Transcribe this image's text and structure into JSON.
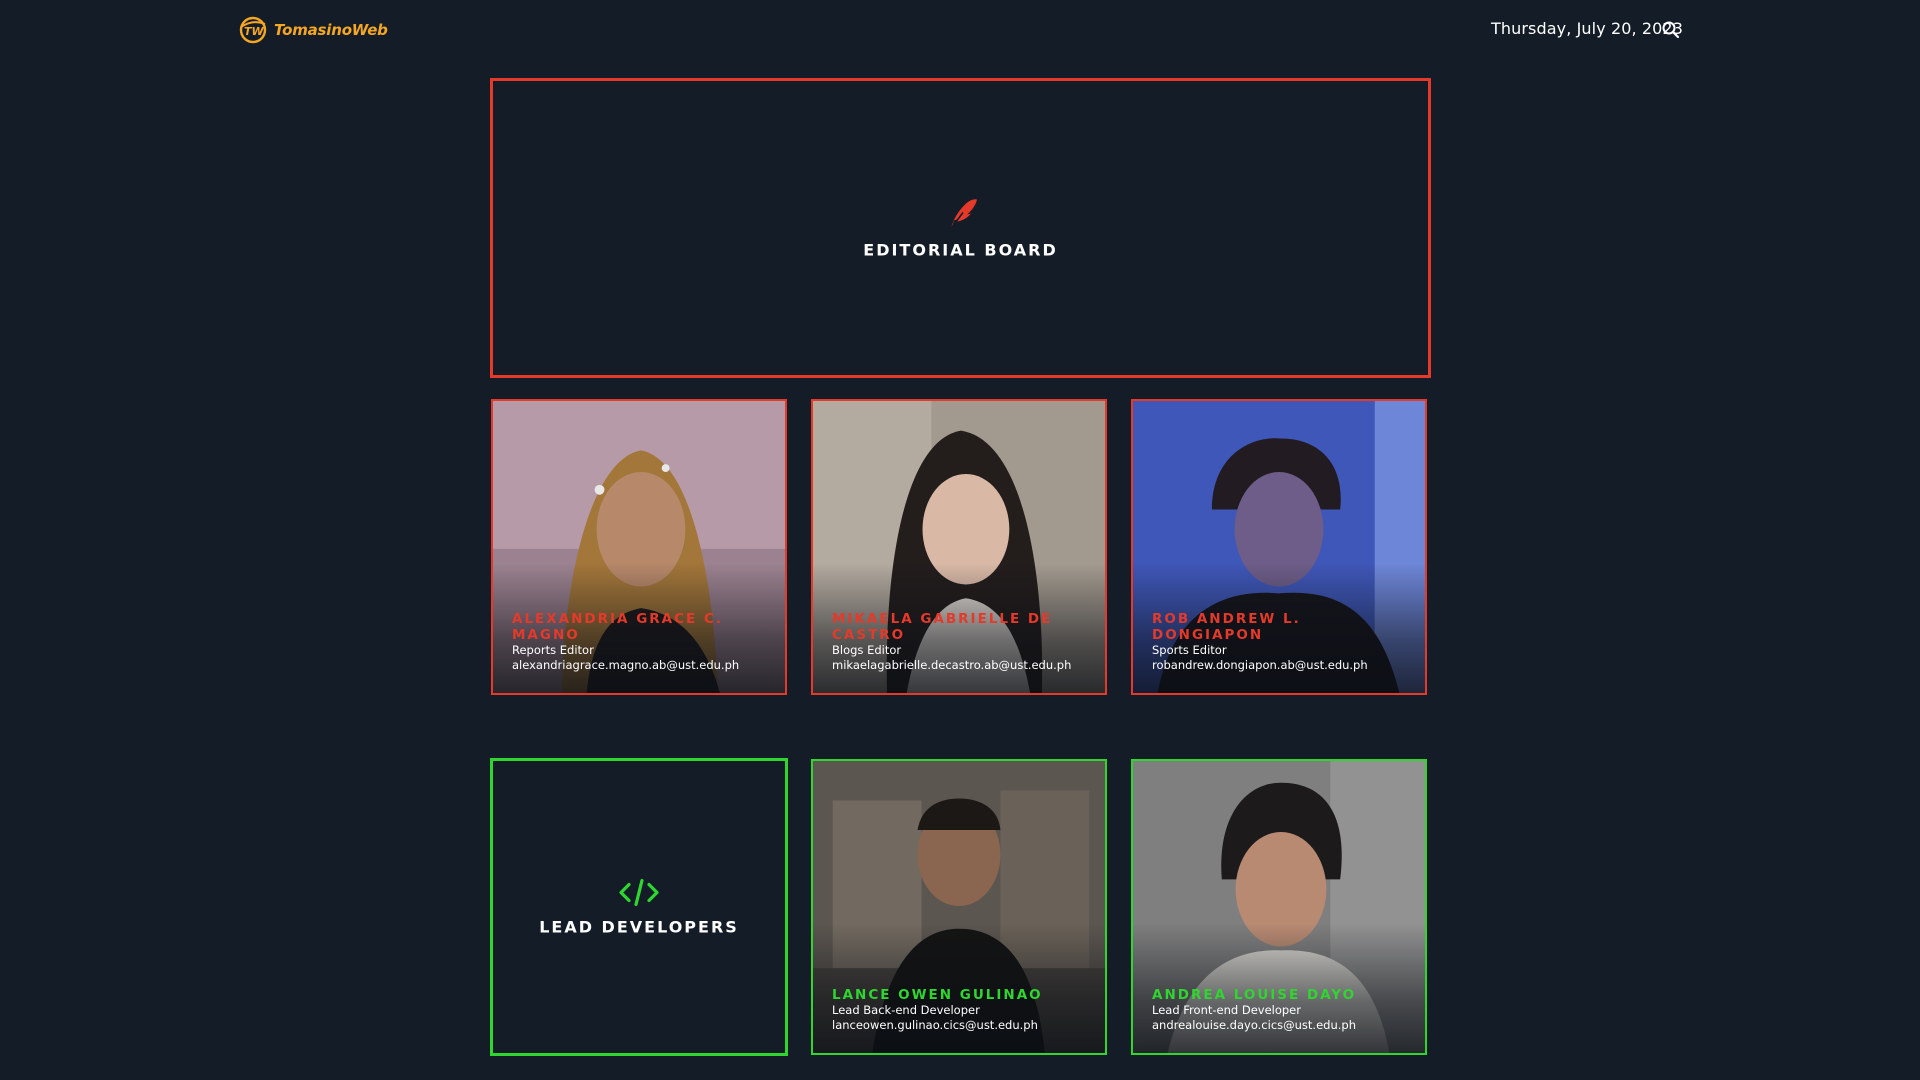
{
  "header": {
    "brand": "TomasinoWeb",
    "date": "Thursday, July 20, 2023"
  },
  "colors": {
    "background": "#141d27",
    "editorial_accent": "#e5392a",
    "developer_accent": "#2fd62f",
    "brand": "#f5a623"
  },
  "editorial_board": {
    "title": "EDITORIAL BOARD",
    "icon": "feather-icon",
    "members": [
      {
        "name": "ALEXANDRIA GRACE C. MAGNO",
        "role": "Reports Editor",
        "email": "alexandriagrace.magno.ab@ust.edu.ph"
      },
      {
        "name": "MIKAELA GABRIELLE DE CASTRO",
        "role": "Blogs Editor",
        "email": "mikaelagabrielle.decastro.ab@ust.edu.ph"
      },
      {
        "name": "ROB ANDREW L. DONGIAPON",
        "role": "Sports Editor",
        "email": "robandrew.dongiapon.ab@ust.edu.ph"
      }
    ]
  },
  "lead_developers": {
    "title": "LEAD DEVELOPERS",
    "icon": "code-icon",
    "members": [
      {
        "name": "LANCE OWEN GULINAO",
        "role": "Lead Back-end Developer",
        "email": "lanceowen.gulinao.cics@ust.edu.ph"
      },
      {
        "name": "ANDREA LOUISE DAYO",
        "role": "Lead Front-end Developer",
        "email": "andrealouise.dayo.cics@ust.edu.ph"
      }
    ]
  }
}
